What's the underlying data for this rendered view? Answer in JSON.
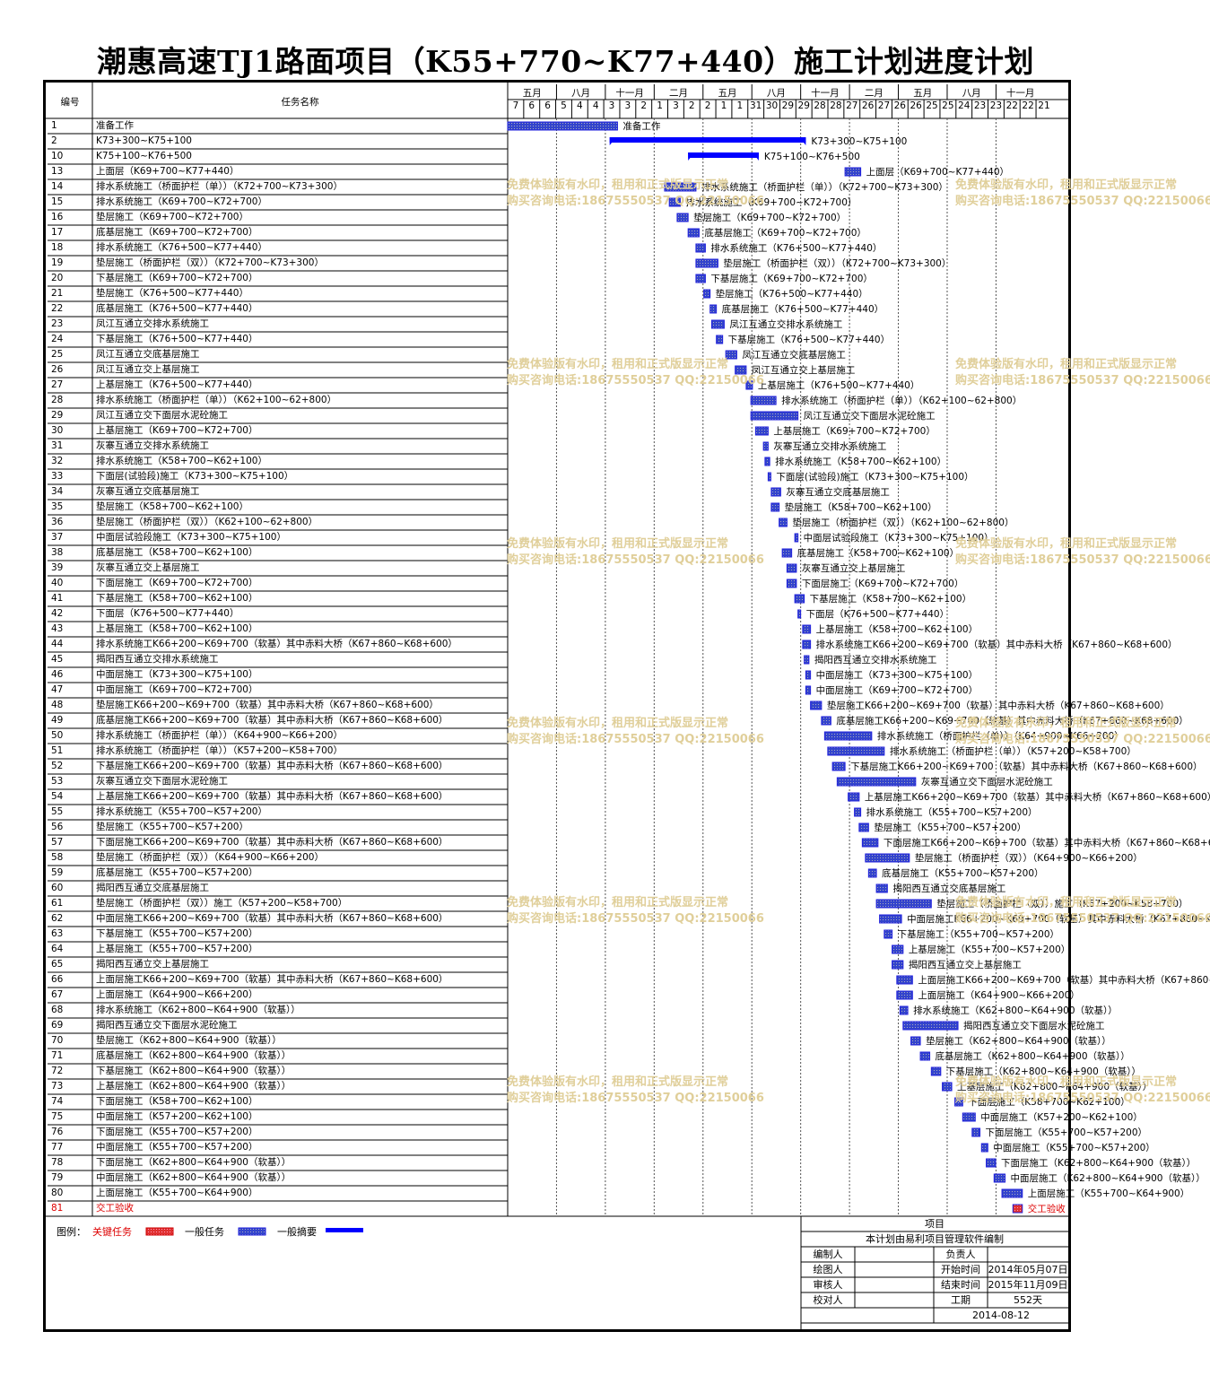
{
  "title": "潮惠高速TJ1路面项目（K55+770~K77+440）施工计划进度计划",
  "header": {
    "col_id": "编号",
    "col_name": "任务名称"
  },
  "timeline": {
    "months": [
      "五月",
      "八月",
      "十一月",
      "二月",
      "五月",
      "八月",
      "十一月",
      "二月",
      "五月",
      "八月",
      "十一月"
    ],
    "days": [
      "7",
      "6",
      "6",
      "5",
      "4",
      "4",
      "3",
      "3",
      "2",
      "1",
      "3",
      "2",
      "2",
      "1",
      "1",
      "31",
      "30",
      "29",
      "29",
      "28",
      "28",
      "27",
      "26",
      "27",
      "26",
      "26",
      "25",
      "25",
      "24",
      "23",
      "23",
      "22",
      "22",
      "21"
    ]
  },
  "tasks": [
    {
      "id": "1",
      "name": "准备工作",
      "s": 0.0,
      "d": 7.0,
      "t": "n"
    },
    {
      "id": "2",
      "name": "K73+300~K75+100",
      "s": 6.5,
      "d": 12.5,
      "t": "s"
    },
    {
      "id": "10",
      "name": "K75+100~K76+500",
      "s": 11.5,
      "d": 4.5,
      "t": "s"
    },
    {
      "id": "13",
      "name": "上面层（K69+700~K77+440）",
      "s": 21.5,
      "d": 1.0,
      "t": "n"
    },
    {
      "id": "14",
      "name": "排水系统施工（桥面护栏（单））（K72+700~K73+300）",
      "s": 10.0,
      "d": 2.0,
      "t": "n"
    },
    {
      "id": "15",
      "name": "排水系统施工（K69+700~K72+700）",
      "s": 10.3,
      "d": 0.7,
      "t": "n"
    },
    {
      "id": "16",
      "name": "垫层施工（K69+700~K72+700）",
      "s": 10.8,
      "d": 0.7,
      "t": "n"
    },
    {
      "id": "17",
      "name": "底基层施工（K69+700~K72+700）",
      "s": 11.5,
      "d": 0.7,
      "t": "n"
    },
    {
      "id": "18",
      "name": "排水系统施工（K76+500~K77+440）",
      "s": 12.0,
      "d": 0.6,
      "t": "n"
    },
    {
      "id": "19",
      "name": "垫层施工（桥面护栏（双））（K72+700~K73+300）",
      "s": 12.0,
      "d": 1.4,
      "t": "n"
    },
    {
      "id": "20",
      "name": "下基层施工（K69+700~K72+700）",
      "s": 12.0,
      "d": 0.6,
      "t": "n"
    },
    {
      "id": "21",
      "name": "垫层施工（K76+500~K77+440）",
      "s": 12.5,
      "d": 0.4,
      "t": "n"
    },
    {
      "id": "22",
      "name": "底基层施工（K76+500~K77+440）",
      "s": 12.9,
      "d": 0.4,
      "t": "n"
    },
    {
      "id": "23",
      "name": "凤江互通立交排水系统施工",
      "s": 13.0,
      "d": 0.8,
      "t": "n"
    },
    {
      "id": "24",
      "name": "下基层施工（K76+500~K77+440）",
      "s": 13.3,
      "d": 0.4,
      "t": "n"
    },
    {
      "id": "25",
      "name": "凤江互通立交底基层施工",
      "s": 13.9,
      "d": 0.7,
      "t": "n"
    },
    {
      "id": "26",
      "name": "凤江互通立交上基层施工",
      "s": 14.5,
      "d": 0.7,
      "t": "n"
    },
    {
      "id": "27",
      "name": "上基层施工（K76+500~K77+440）",
      "s": 15.2,
      "d": 0.4,
      "t": "n"
    },
    {
      "id": "28",
      "name": "排水系统施工（桥面护栏（单））（K62+100~62+800）",
      "s": 15.5,
      "d": 1.6,
      "t": "n"
    },
    {
      "id": "29",
      "name": "凤江互通立交下面层水泥砼施工",
      "s": 15.5,
      "d": 3.0,
      "t": "n"
    },
    {
      "id": "30",
      "name": "上基层施工（K69+700~K72+700）",
      "s": 15.8,
      "d": 0.8,
      "t": "n"
    },
    {
      "id": "31",
      "name": "灰寨互通立交排水系统施工",
      "s": 16.3,
      "d": 0.3,
      "t": "n"
    },
    {
      "id": "32",
      "name": "排水系统施工（K58+700~K62+100）",
      "s": 16.4,
      "d": 0.3,
      "t": "n"
    },
    {
      "id": "33",
      "name": "下面层(试验段)施工（K73+300~K75+100）",
      "s": 16.6,
      "d": 0.15,
      "t": "n"
    },
    {
      "id": "34",
      "name": "灰寨互通立交底基层施工",
      "s": 16.8,
      "d": 0.6,
      "t": "n"
    },
    {
      "id": "35",
      "name": "垫层施工（K58+700~K62+100）",
      "s": 16.8,
      "d": 0.5,
      "t": "n"
    },
    {
      "id": "36",
      "name": "垫层施工（桥面护栏（双））（K62+100~62+800）",
      "s": 17.3,
      "d": 0.5,
      "t": "n"
    },
    {
      "id": "37",
      "name": "中面层试验段施工（K73+300~K75+100）",
      "s": 18.3,
      "d": 0.2,
      "t": "n"
    },
    {
      "id": "38",
      "name": "底基层施工（K58+700~K62+100）",
      "s": 17.5,
      "d": 0.6,
      "t": "n"
    },
    {
      "id": "39",
      "name": "灰寨互通立交上基层施工",
      "s": 17.8,
      "d": 0.6,
      "t": "n"
    },
    {
      "id": "40",
      "name": "下面层施工（K69+700~K72+700）",
      "s": 17.8,
      "d": 0.6,
      "t": "n"
    },
    {
      "id": "41",
      "name": "下基层施工（K58+700~K62+100）",
      "s": 18.3,
      "d": 0.6,
      "t": "n"
    },
    {
      "id": "42",
      "name": "下面层（K76+500~K77+440）",
      "s": 18.5,
      "d": 0.15,
      "t": "n"
    },
    {
      "id": "43",
      "name": "上基层施工（K58+700~K62+100）",
      "s": 18.8,
      "d": 0.5,
      "t": "n"
    },
    {
      "id": "44",
      "name": "排水系统施工K66+200~K69+700（软基）其中赤料大桥（K67+860~K68+600）",
      "s": 18.8,
      "d": 0.5,
      "t": "n"
    },
    {
      "id": "45",
      "name": "揭阳西互通立交排水系统施工",
      "s": 18.9,
      "d": 0.3,
      "t": "n"
    },
    {
      "id": "46",
      "name": "中面层施工（K73+300~K75+100）",
      "s": 19.0,
      "d": 0.3,
      "t": "n"
    },
    {
      "id": "47",
      "name": "中面层施工（K69+700~K72+700）",
      "s": 19.0,
      "d": 0.3,
      "t": "n"
    },
    {
      "id": "48",
      "name": "垫层施工K66+200~K69+700（软基）其中赤料大桥（K67+860~K68+600）",
      "s": 19.3,
      "d": 0.7,
      "t": "n"
    },
    {
      "id": "49",
      "name": "底基层施工K66+200~K69+700（软基）其中赤料大桥（K67+860~K68+600）",
      "s": 20.0,
      "d": 0.6,
      "t": "n"
    },
    {
      "id": "50",
      "name": "排水系统施工（桥面护栏（单））（K64+900~K66+200）",
      "s": 20.2,
      "d": 3.0,
      "t": "n"
    },
    {
      "id": "51",
      "name": "排水系统施工（桥面护栏（单））（K57+200~K58+700）",
      "s": 20.4,
      "d": 3.6,
      "t": "n"
    },
    {
      "id": "52",
      "name": "下基层施工K66+200~K69+700（软基）其中赤料大桥（K67+860~K68+600）",
      "s": 20.7,
      "d": 0.8,
      "t": "n"
    },
    {
      "id": "53",
      "name": "灰寨互通立交下面层水泥砼施工",
      "s": 21.0,
      "d": 5.0,
      "t": "n"
    },
    {
      "id": "54",
      "name": "上基层施工K66+200~K69+700（软基）其中赤料大桥（K67+860~K68+600）",
      "s": 21.7,
      "d": 0.7,
      "t": "n"
    },
    {
      "id": "55",
      "name": "排水系统施工（K55+700~K57+200）",
      "s": 22.1,
      "d": 0.4,
      "t": "n"
    },
    {
      "id": "56",
      "name": "垫层施工（K55+700~K57+200）",
      "s": 22.4,
      "d": 0.6,
      "t": "n"
    },
    {
      "id": "57",
      "name": "下面层施工K66+200~K69+700（软基）其中赤料大桥（K67+860~K68+600）",
      "s": 22.6,
      "d": 1.0,
      "t": "n"
    },
    {
      "id": "58",
      "name": "垫层施工（桥面护栏（双））（K64+900~K66+200）",
      "s": 22.8,
      "d": 2.8,
      "t": "n"
    },
    {
      "id": "59",
      "name": "底基层施工（K55+700~K57+200）",
      "s": 23.0,
      "d": 0.5,
      "t": "n"
    },
    {
      "id": "60",
      "name": "揭阳西互通立交底基层施工",
      "s": 23.5,
      "d": 0.7,
      "t": "n"
    },
    {
      "id": "61",
      "name": "垫层施工（桥面护栏（双））施工（K57+200~K58+700）",
      "s": 23.5,
      "d": 3.5,
      "t": "n"
    },
    {
      "id": "62",
      "name": "中面层施工K66+200~K69+700（软基）其中赤料大桥（K67+860~K68+600）",
      "s": 23.7,
      "d": 1.4,
      "t": "n"
    },
    {
      "id": "63",
      "name": "下基层施工（K55+700~K57+200）",
      "s": 24.0,
      "d": 0.5,
      "t": "n"
    },
    {
      "id": "64",
      "name": "上基层施工（K55+700~K57+200）",
      "s": 24.5,
      "d": 0.7,
      "t": "n"
    },
    {
      "id": "65",
      "name": "揭阳西互通立交上基层施工",
      "s": 24.5,
      "d": 0.7,
      "t": "n"
    },
    {
      "id": "66",
      "name": "上面层施工K66+200~K69+700（软基）其中赤料大桥（K67+860~K68+600）",
      "s": 24.8,
      "d": 1.0,
      "t": "n"
    },
    {
      "id": "67",
      "name": "上面层施工（K64+900~K66+200）",
      "s": 24.8,
      "d": 1.0,
      "t": "n"
    },
    {
      "id": "68",
      "name": "排水系统施工（K62+800~K64+900（软基））",
      "s": 25.0,
      "d": 0.5,
      "t": "n"
    },
    {
      "id": "69",
      "name": "揭阳西互通立交下面层水泥砼施工",
      "s": 25.2,
      "d": 3.5,
      "t": "n"
    },
    {
      "id": "70",
      "name": "垫层施工（K62+800~K64+900（软基））",
      "s": 25.7,
      "d": 0.6,
      "t": "n"
    },
    {
      "id": "71",
      "name": "底基层施工（K62+800~K64+900（软基））",
      "s": 26.3,
      "d": 0.6,
      "t": "n"
    },
    {
      "id": "72",
      "name": "下基层施工（K62+800~K64+900（软基））",
      "s": 27.0,
      "d": 0.6,
      "t": "n"
    },
    {
      "id": "73",
      "name": "上基层施工（K62+800~K64+900（软基））",
      "s": 27.7,
      "d": 0.6,
      "t": "n"
    },
    {
      "id": "74",
      "name": "下面层施工（K58+700~K62+100）",
      "s": 28.5,
      "d": 0.5,
      "t": "n"
    },
    {
      "id": "75",
      "name": "中面层施工（K57+200~K62+100）",
      "s": 29.0,
      "d": 0.8,
      "t": "n"
    },
    {
      "id": "76",
      "name": "下面层施工（K55+700~K57+200）",
      "s": 29.6,
      "d": 0.5,
      "t": "n"
    },
    {
      "id": "77",
      "name": "中面层施工（K55+700~K57+200）",
      "s": 30.2,
      "d": 0.4,
      "t": "n"
    },
    {
      "id": "78",
      "name": "下面层施工（K62+800~K64+900（软基））",
      "s": 30.5,
      "d": 0.6,
      "t": "n"
    },
    {
      "id": "79",
      "name": "中面层施工（K62+800~K64+900（软基））",
      "s": 31.0,
      "d": 0.7,
      "t": "n"
    },
    {
      "id": "80",
      "name": "上面层施工（K55+700~K64+900）",
      "s": 31.5,
      "d": 1.3,
      "t": "n"
    },
    {
      "id": "81",
      "name": "交工验收",
      "s": 32.2,
      "d": 0.6,
      "t": "c"
    }
  ],
  "watermark": {
    "line1": "免费体验版有水印，租用和正式版显示正常",
    "line2": "购买咨询电话:18675550537 QQ:22150066"
  },
  "legend": {
    "label": "图例：",
    "critical": "关键任务",
    "normal": "一般任务",
    "summary": "一般摘要",
    "colors": {
      "critical": "#e03030",
      "normal": "#3344cc",
      "summary": "#0000ff",
      "critical_text": "#dd0000"
    }
  },
  "info": {
    "project_label": "项目",
    "software_note": "本计划由易利项目管理软件编制",
    "editor_label": "编制人",
    "owner_label": "负责人",
    "drawer_label": "绘图人",
    "start_label": "开始时间",
    "start_value": "2014年05月07日",
    "reviewer_label": "审核人",
    "end_label": "结束时间",
    "end_value": "2015年11月09日",
    "checker_label": "校对人",
    "duration_label": "工期",
    "duration_value": "552天",
    "date": "2014-08-12"
  }
}
